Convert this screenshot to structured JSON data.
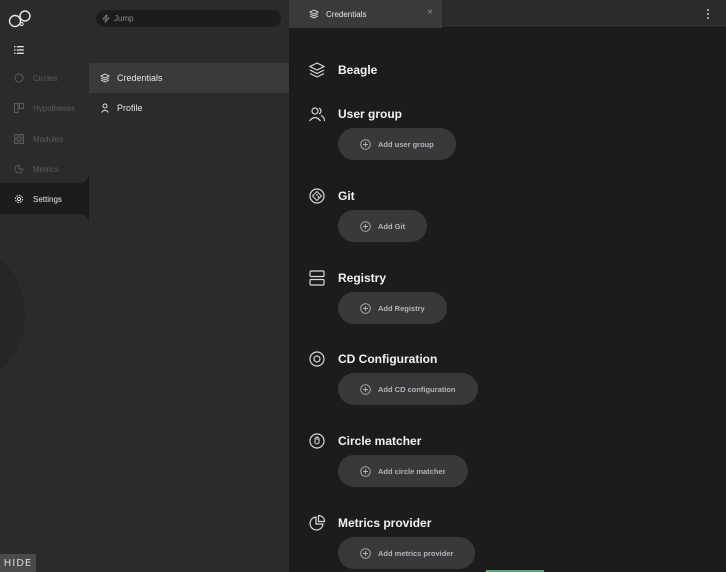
{
  "rail": {
    "items": [
      {
        "label": "Circles",
        "icon": "circle-icon"
      },
      {
        "label": "Hypotheses",
        "icon": "hypotheses-icon"
      },
      {
        "label": "Modules",
        "icon": "modules-icon"
      },
      {
        "label": "Metrics",
        "icon": "metrics-icon"
      },
      {
        "label": "Settings",
        "icon": "gear-icon",
        "active": true
      }
    ],
    "hide_label": "HIDE"
  },
  "midpanel": {
    "jump_placeholder": "Jump",
    "items": [
      {
        "label": "Credentials",
        "icon": "layers-icon",
        "active": true
      },
      {
        "label": "Profile",
        "icon": "user-icon"
      }
    ]
  },
  "tab": {
    "label": "Credentials",
    "close": "×"
  },
  "sections": [
    {
      "title": "Beagle",
      "icon": "layers-icon",
      "button": ""
    },
    {
      "title": "User group",
      "icon": "users-icon",
      "button": "Add user group"
    },
    {
      "title": "Git",
      "icon": "git-icon",
      "button": "Add Git"
    },
    {
      "title": "Registry",
      "icon": "registry-icon",
      "button": "Add Registry"
    },
    {
      "title": "CD Configuration",
      "icon": "cd-config-icon",
      "button": "Add CD configuration"
    },
    {
      "title": "Circle matcher",
      "icon": "circle-matcher-icon",
      "button": "Add circle matcher"
    },
    {
      "title": "Metrics provider",
      "icon": "metrics-provider-icon",
      "button": "Add metrics provider"
    }
  ],
  "colors": {
    "background": "#1c1c1e",
    "panel": "#2b2b2d",
    "button": "#39393b",
    "accent_green": "#4caf71"
  }
}
